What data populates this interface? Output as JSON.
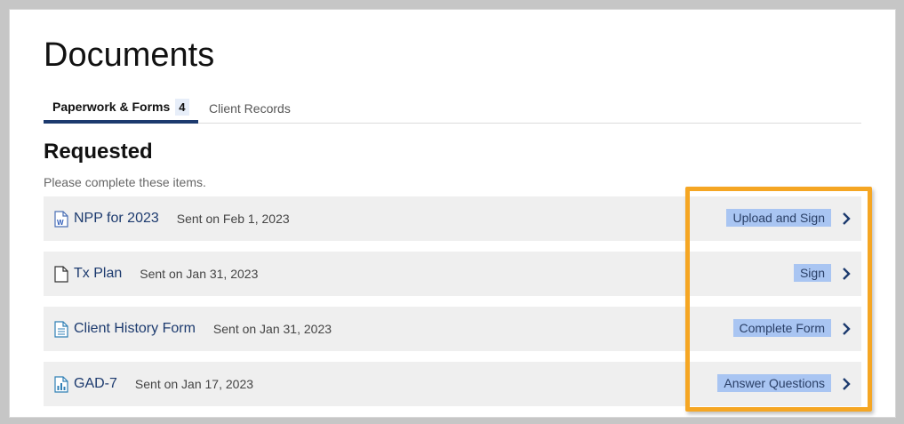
{
  "page": {
    "title": "Documents"
  },
  "tabs": [
    {
      "label": "Paperwork & Forms",
      "count": "4",
      "active": true
    },
    {
      "label": "Client Records",
      "active": false
    }
  ],
  "section": {
    "title": "Requested",
    "subtitle": "Please complete these items."
  },
  "items": [
    {
      "icon": "word-document-icon",
      "name": "NPP for 2023",
      "sent": "Sent on Feb 1, 2023",
      "action": "Upload and Sign"
    },
    {
      "icon": "blank-document-icon",
      "name": "Tx Plan",
      "sent": "Sent on Jan 31, 2023",
      "action": "Sign"
    },
    {
      "icon": "form-document-icon",
      "name": "Client History Form",
      "sent": "Sent on Jan 31, 2023",
      "action": "Complete Form"
    },
    {
      "icon": "chart-document-icon",
      "name": "GAD-7",
      "sent": "Sent on Jan 17, 2023",
      "action": "Answer Questions"
    }
  ],
  "colors": {
    "accent": "#1c3a6e",
    "action_badge": "#a9c5f2",
    "highlight": "#f5a623",
    "row_bg": "#efefef"
  }
}
